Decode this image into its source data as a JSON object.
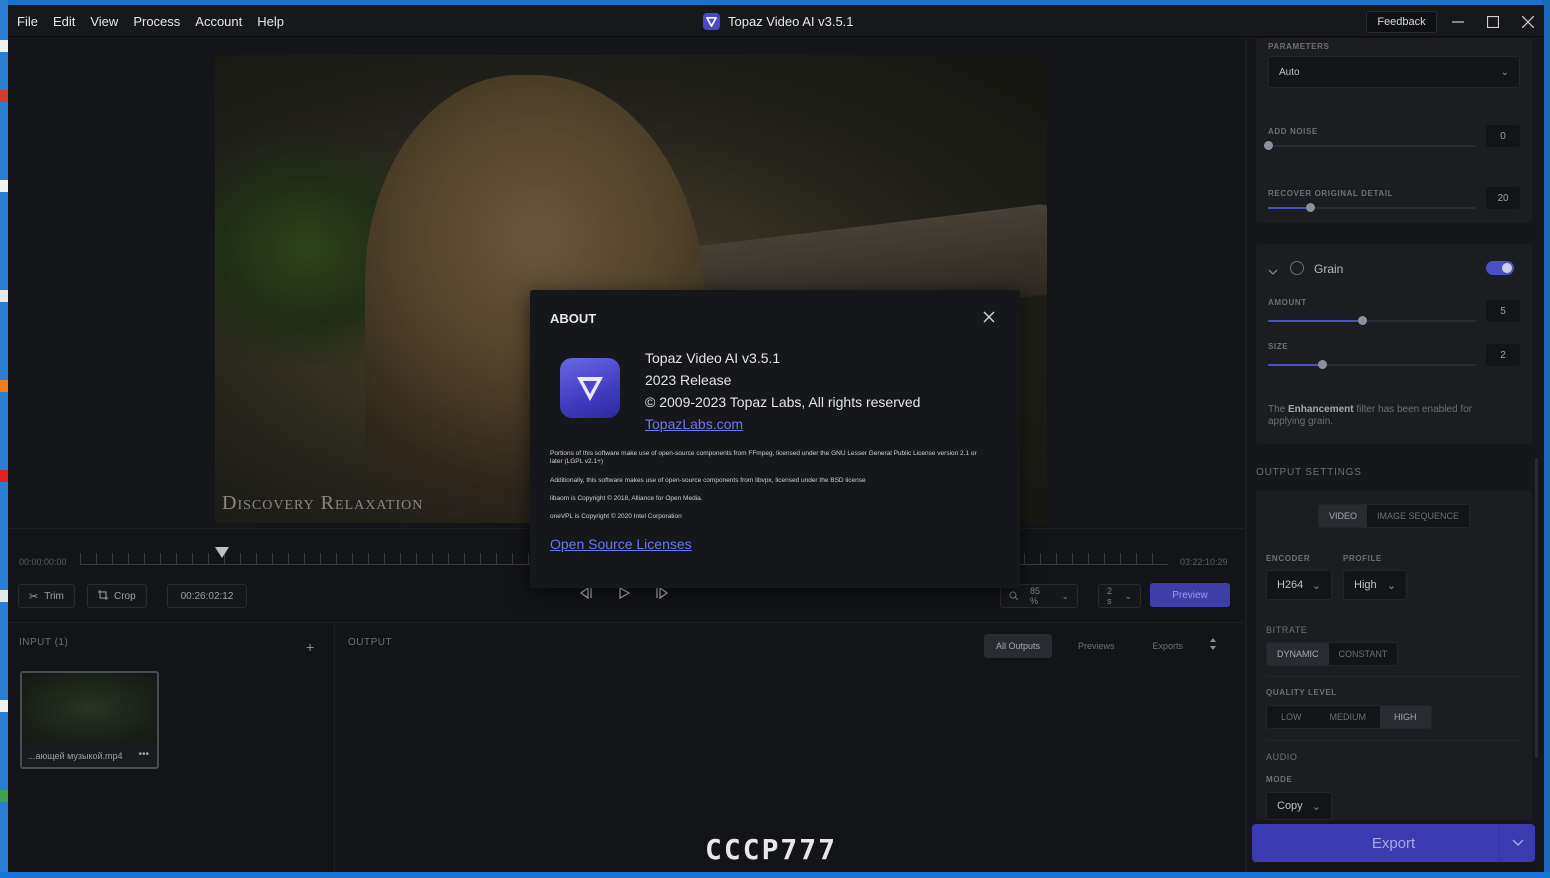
{
  "window": {
    "title": "Topaz Video AI  v3.5.1",
    "menu": [
      "File",
      "Edit",
      "View",
      "Process",
      "Account",
      "Help"
    ],
    "feedback_label": "Feedback"
  },
  "viewer": {
    "watermark": "Discovery Relaxation",
    "time_start": "00:00:00:00",
    "time_end": "03:22:10:29",
    "trim_label": "Trim",
    "crop_label": "Crop",
    "duration": "00:26:02:12",
    "zoom_value": "85 %",
    "split_value": "2 s",
    "preview_label": "Preview"
  },
  "input_panel": {
    "header": "INPUT (1)",
    "add_symbol": "+",
    "file_name": "...ающей музыкой.mp4",
    "more_symbol": "•••"
  },
  "output_panel": {
    "header": "OUTPUT",
    "tabs": [
      "All Outputs",
      "Previews",
      "Exports"
    ]
  },
  "about": {
    "heading": "ABOUT",
    "product": "Topaz Video AI  v3.5.1",
    "release": "2023 Release",
    "copyright": "© 2009-2023 Topaz Labs, All rights reserved",
    "website": "TopazLabs.com",
    "notice_ffmpeg": "Portions of this software make use of open-source components from FFmpeg, licensed under the GNU Lesser General Public License version 2.1 or later (LGPL v2.1+)",
    "notice_libvpx": "Additionally, this software makes use of open-source components from libvpx, licensed under the BSD license",
    "notice_libaom": "libaom is Copyright © 2018, Alliance for Open Media.",
    "notice_onevpl": "oneVPL is Copyright © 2020 Intel Corporation",
    "oss_link": "Open Source Licenses"
  },
  "sidebar": {
    "parameters_label": "PARAMETERS",
    "parameters_value": "Auto",
    "add_noise_label": "ADD NOISE",
    "add_noise_value": "0",
    "add_noise_level": 0,
    "recover_label": "RECOVER ORIGINAL DETAIL",
    "recover_value": "20",
    "recover_level": 0.2,
    "grain_title": "Grain",
    "grain_enabled": true,
    "amount_label": "AMOUNT",
    "amount_value": "5",
    "amount_level": 0.45,
    "size_label": "SIZE",
    "size_value": "2",
    "size_level": 0.26,
    "grain_note_pre": "The ",
    "grain_note_bold": "Enhancement",
    "grain_note_post": " filter has been enabled for applying grain.",
    "output_settings_label": "OUTPUT SETTINGS",
    "output_modes": [
      "VIDEO",
      "IMAGE SEQUENCE"
    ],
    "encoder_label": "ENCODER",
    "encoder_value": "H264",
    "profile_label": "PROFILE",
    "profile_value": "High",
    "bitrate_label": "BITRATE",
    "bitrate_modes": [
      "DYNAMIC",
      "CONSTANT"
    ],
    "quality_label": "QUALITY LEVEL",
    "quality_modes": [
      "LOW",
      "MEDIUM",
      "HIGH"
    ],
    "audio_label": "AUDIO",
    "mode_label": "MODE",
    "mode_value": "Copy",
    "export_label": "Export"
  },
  "overlay_text": "CCCP777",
  "colors": {
    "accent": "#4b52c8",
    "link": "#6a78f0",
    "background": "#131417",
    "panel": "#1c1d21"
  }
}
